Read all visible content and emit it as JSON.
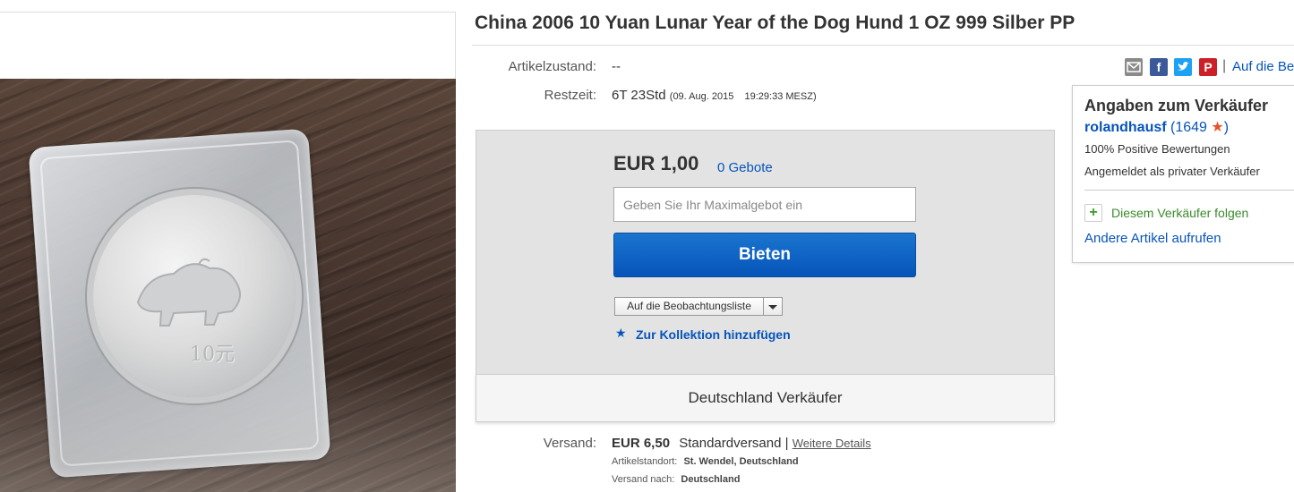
{
  "title": "China 2006 10 Yuan Lunar Year of the Dog Hund 1 OZ 999 Silber PP",
  "image": {
    "coin_value_text": "10元"
  },
  "condition": {
    "label": "Artikelzustand:",
    "value": "--"
  },
  "time_left": {
    "label": "Restzeit:",
    "value": "6T 23Std",
    "date": "(09. Aug. 2015",
    "time": "19:29:33 MESZ)"
  },
  "share": {
    "icons": [
      "mail-icon",
      "facebook-icon",
      "twitter-icon",
      "pinterest-icon"
    ],
    "separator": "|",
    "watch_link": "Auf die Be"
  },
  "bid": {
    "price": "EUR 1,00",
    "bids": "0 Gebote",
    "input_placeholder": "Geben Sie Ihr Maximalgebot ein",
    "button": "Bieten",
    "watch_label": "Auf die Beobachtungsliste",
    "collection_link": "Zur Kollektion hinzufügen",
    "location_text": "Deutschland Verkäufer"
  },
  "shipping": {
    "label": "Versand:",
    "price": "EUR 6,50",
    "method": "Standardversand |",
    "details_link": "Weitere Details",
    "location_label": "Artikelstandort:",
    "location_value": "St. Wendel, Deutschland",
    "ships_to_label": "Versand nach:",
    "ships_to_value": "Deutschland"
  },
  "seller": {
    "title": "Angaben zum Verkäufer",
    "name": "rolandhausf",
    "feedback_open": "(",
    "feedback_score": "1649",
    "feedback_close": ")",
    "positive": "100% Positive Bewertungen",
    "type": "Angemeldet als privater Verkäufer",
    "follow": "Diesem Verkäufer folgen",
    "other_items": "Andere Artikel aufrufen"
  },
  "colors": {
    "link": "#0654ba",
    "button": "#0654ba",
    "star": "#e8512b",
    "follow": "#3a8a2a"
  }
}
